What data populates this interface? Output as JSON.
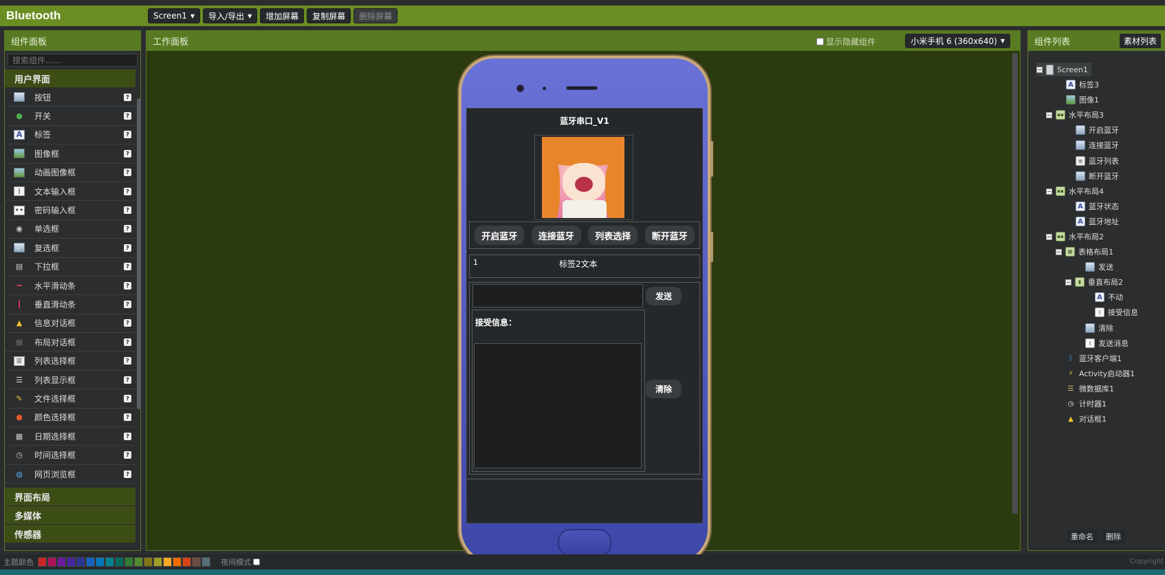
{
  "topbar": {
    "title": "Bluetooth",
    "screen_select": "Screen1",
    "import_export": "导入/导出",
    "add_screen": "增加屏幕",
    "copy_screen": "复制屏幕",
    "delete_screen": "删除屏幕"
  },
  "palette": {
    "title": "组件面板",
    "search_placeholder": "搜索组件......",
    "category": "用户界面",
    "items": [
      {
        "label": "按钮",
        "icon": "button-icon"
      },
      {
        "label": "开关",
        "icon": "switch-icon"
      },
      {
        "label": "标签",
        "icon": "label-icon"
      },
      {
        "label": "图像框",
        "icon": "image-icon"
      },
      {
        "label": "动画图像框",
        "icon": "animated-image-icon"
      },
      {
        "label": "文本输入框",
        "icon": "textbox-icon"
      },
      {
        "label": "密码输入框",
        "icon": "password-icon"
      },
      {
        "label": "单选框",
        "icon": "radio-icon"
      },
      {
        "label": "复选框",
        "icon": "checkbox-icon"
      },
      {
        "label": "下拉框",
        "icon": "dropdown-icon"
      },
      {
        "label": "水平滑动条",
        "icon": "hslider-icon"
      },
      {
        "label": "垂直滑动条",
        "icon": "vslider-icon"
      },
      {
        "label": "信息对话框",
        "icon": "notifier-icon"
      },
      {
        "label": "布局对话框",
        "icon": "layout-dialog-icon"
      },
      {
        "label": "列表选择框",
        "icon": "listpicker-icon"
      },
      {
        "label": "列表显示框",
        "icon": "listview-icon"
      },
      {
        "label": "文件选择框",
        "icon": "filepicker-icon"
      },
      {
        "label": "颜色选择框",
        "icon": "colorpicker-icon"
      },
      {
        "label": "日期选择框",
        "icon": "datepicker-icon"
      },
      {
        "label": "时间选择框",
        "icon": "timepicker-icon"
      },
      {
        "label": "网页浏览框",
        "icon": "webviewer-icon"
      }
    ],
    "more_categories": [
      "界面布局",
      "多媒体",
      "传感器"
    ]
  },
  "workspace": {
    "title": "工作面板",
    "show_hidden": "显示隐藏组件",
    "device": "小米手机 6 (360x640)"
  },
  "app_screen": {
    "title": "蓝牙串口_V1",
    "buttons": [
      "开启蓝牙",
      "连接蓝牙",
      "列表选择",
      "断开蓝牙"
    ],
    "label_num": "1",
    "label_text": "标签2文本",
    "send_button": "发送",
    "receive_label": "接受信息：",
    "clear_button": "清除"
  },
  "tree": {
    "title": "组件列表",
    "assets_button": "素材列表",
    "items": [
      {
        "label": "Screen1",
        "icon": "screen-icon"
      },
      {
        "label": "标签3",
        "icon": "label-icon"
      },
      {
        "label": "图像1",
        "icon": "image-icon"
      },
      {
        "label": "水平布局3",
        "icon": "horizontal-layout-icon"
      },
      {
        "label": "开启蓝牙",
        "icon": "button-icon"
      },
      {
        "label": "连接蓝牙",
        "icon": "button-icon"
      },
      {
        "label": "蓝牙列表",
        "icon": "listpicker-icon"
      },
      {
        "label": "断开蓝牙",
        "icon": "button-icon"
      },
      {
        "label": "水平布局4",
        "icon": "horizontal-layout-icon"
      },
      {
        "label": "蓝牙状态",
        "icon": "label-icon"
      },
      {
        "label": "蓝牙地址",
        "icon": "label-icon"
      },
      {
        "label": "水平布局2",
        "icon": "horizontal-layout-icon"
      },
      {
        "label": "表格布局1",
        "icon": "table-layout-icon"
      },
      {
        "label": "发送",
        "icon": "button-icon"
      },
      {
        "label": "垂直布局2",
        "icon": "vertical-layout-icon"
      },
      {
        "label": "不动",
        "icon": "label-icon"
      },
      {
        "label": "接受信息",
        "icon": "textbox-icon"
      },
      {
        "label": "清除",
        "icon": "button-icon"
      },
      {
        "label": "发送消息",
        "icon": "textbox-icon"
      },
      {
        "label": "蓝牙客户端1",
        "icon": "bluetooth-icon"
      },
      {
        "label": "Activity启动器1",
        "icon": "activity-starter-icon"
      },
      {
        "label": "微数据库1",
        "icon": "tinydb-icon"
      },
      {
        "label": "计时器1",
        "icon": "clock-icon"
      },
      {
        "label": "对话框1",
        "icon": "notifier-icon"
      }
    ],
    "rename_button": "重命名",
    "delete_button": "删除"
  },
  "bottombar": {
    "theme_label": "主题颜色",
    "night_label": "夜间模式",
    "copyright": "Copyright",
    "swatches": [
      "#c62828",
      "#ad1457",
      "#6a1b9a",
      "#4527a0",
      "#283593",
      "#1565c0",
      "#0277bd",
      "#00838f",
      "#00695c",
      "#2e7d32",
      "#558b2f",
      "#827717",
      "#9e9d24",
      "#f9a825",
      "#ef6c00",
      "#d84315",
      "#6d4c41",
      "#546e7a"
    ]
  }
}
